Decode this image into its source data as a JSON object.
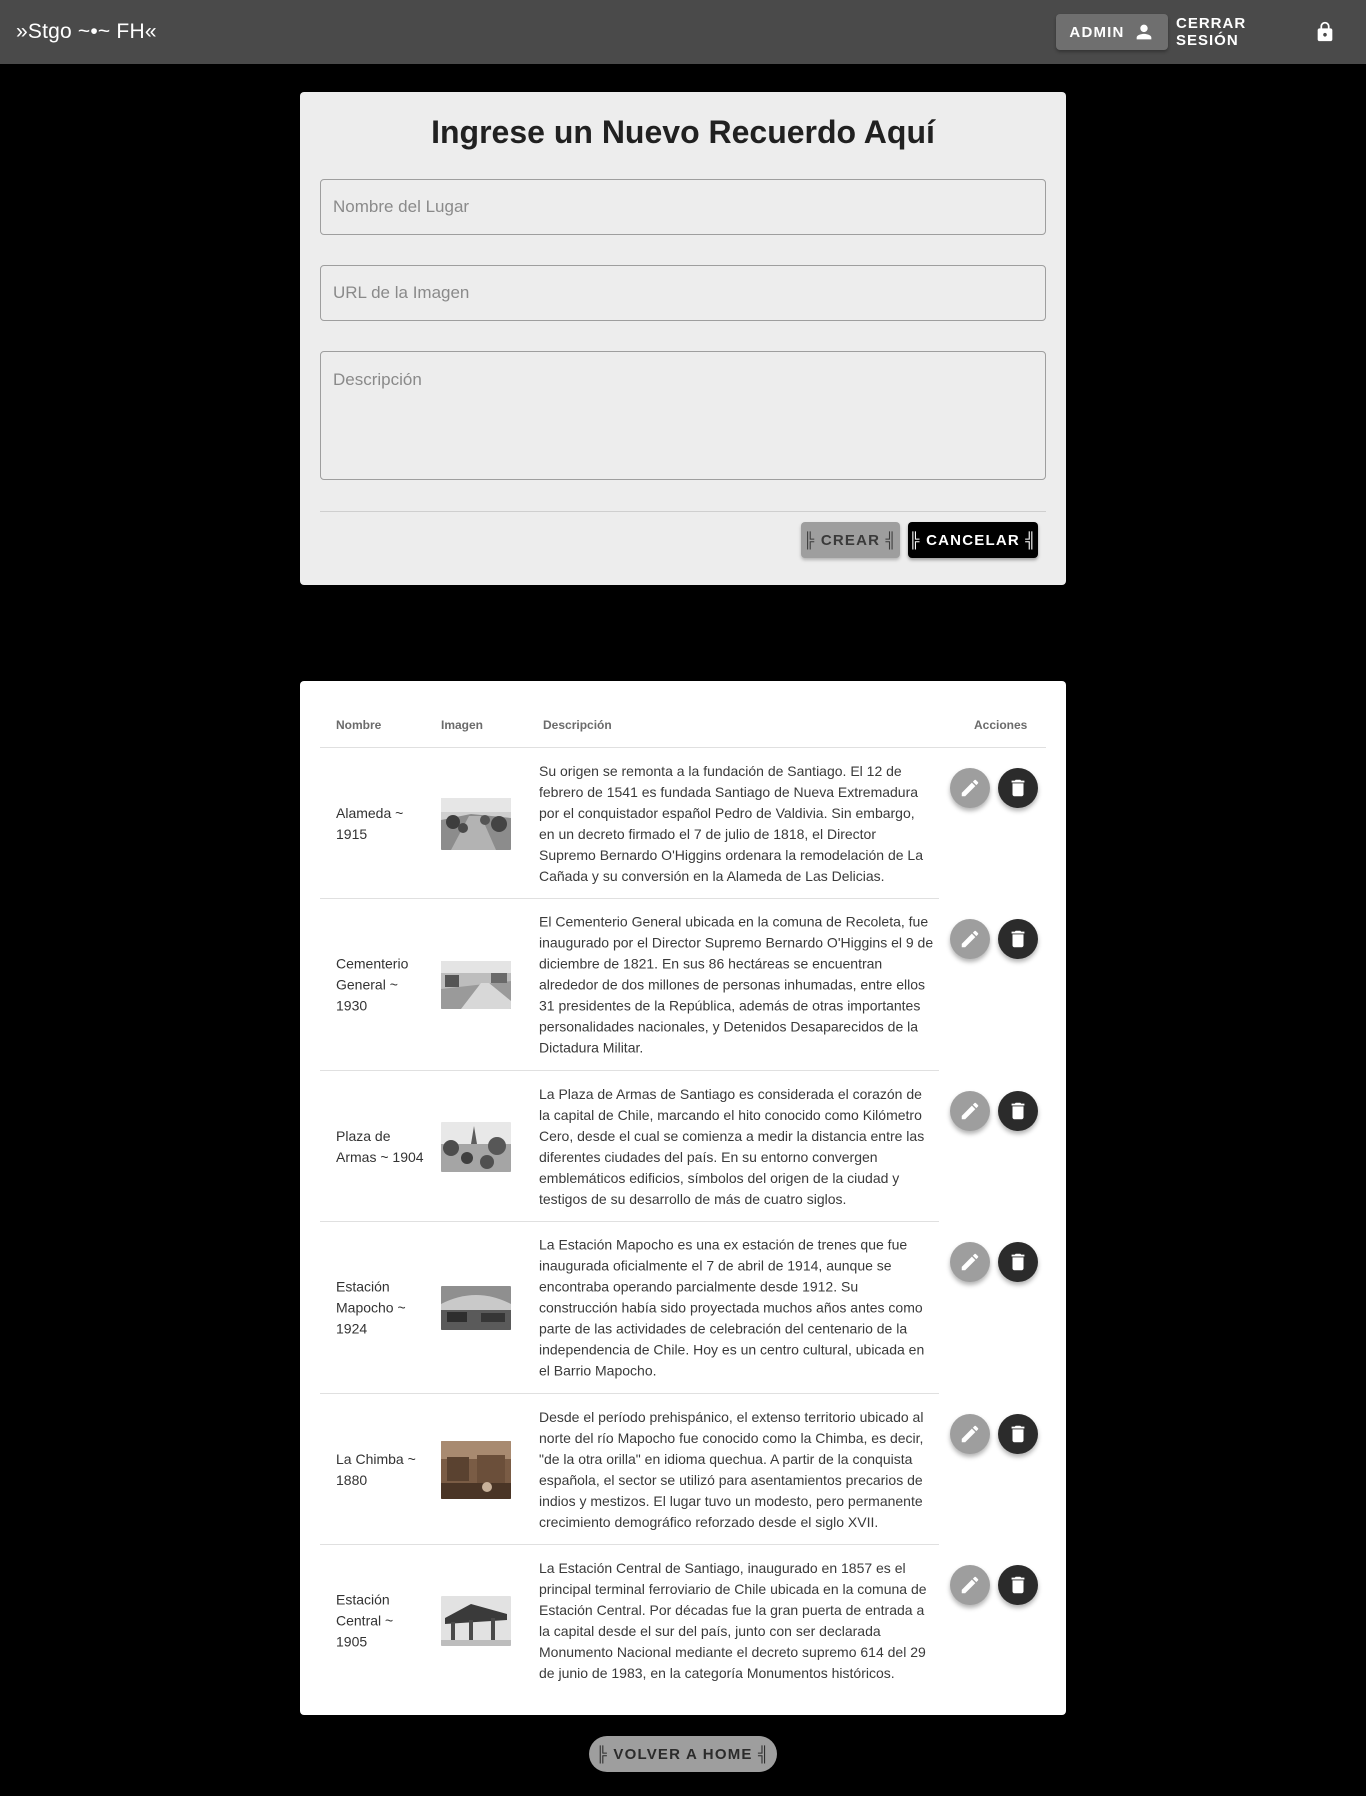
{
  "header": {
    "brand": "»Stgo ~•~ FH«",
    "admin_label": "ADMIN",
    "logout_label": "CERRAR SESIÓN"
  },
  "form": {
    "title": "Ingrese un Nuevo Recuerdo Aquí",
    "name_placeholder": "Nombre del Lugar",
    "url_placeholder": "URL de la Imagen",
    "desc_placeholder": "Descripción",
    "create_label": "╠ CREAR ╣",
    "cancel_label": "╠ CANCELAR ╣"
  },
  "table": {
    "headers": [
      "Nombre",
      "Imagen",
      "Descripción",
      "Acciones"
    ],
    "rows": [
      {
        "name": "Alameda ~ 1915",
        "description": "Su origen se remonta a la fundación de Santiago. El 12 de febrero de 1541 es fundada Santiago de Nueva Extremadura por el conquistador español Pedro de Valdivia. Sin embargo, en un decreto firmado el 7 de julio de 1818, el Director Supremo Bernardo O'Higgins ordenara la remodelación de La Cañada y su conversión en la Alameda de Las Delicias."
      },
      {
        "name": "Cementerio General ~ 1930",
        "description": "El Cementerio General ubicada en la comuna de Recoleta, fue inaugurado por el Director Supremo Bernardo O'Higgins el 9 de diciembre de 1821. En sus 86 hectáreas se encuentran alrededor de dos millones de personas inhumadas, entre ellos 31 presidentes de la República, además de otras importantes personalidades nacionales, y Detenidos Desaparecidos de la Dictadura Militar."
      },
      {
        "name": "Plaza de Armas ~ 1904",
        "description": "La Plaza de Armas de Santiago es considerada el corazón de la capital de Chile, marcando el hito conocido como Kilómetro Cero, desde el cual se comienza a medir la distancia entre las diferentes ciudades del país. En su entorno convergen emblemáticos edificios, símbolos del origen de la ciudad y testigos de su desarrollo de más de cuatro siglos."
      },
      {
        "name": "Estación Mapocho ~ 1924",
        "description": "La Estación Mapocho es una ex estación de trenes que fue inaugurada oficialmente el 7 de abril de 1914, aunque se encontraba operando parcialmente desde 1912. Su construcción había sido proyectada muchos años antes como parte de las actividades de celebración del centenario de la independencia de Chile. Hoy es un centro cultural, ubicada en el Barrio Mapocho."
      },
      {
        "name": "La Chimba ~ 1880",
        "description": "Desde el período prehispánico, el extenso territorio ubicado al norte del río Mapocho fue conocido como la Chimba, es decir, \"de la otra orilla\" en idioma quechua. A partir de la conquista española, el sector se utilizó para asentamientos precarios de indios y mestizos. El lugar tuvo un modesto, pero permanente crecimiento demográfico reforzado desde el siglo XVII."
      },
      {
        "name": "Estación Central ~ 1905",
        "description": "La Estación Central de Santiago, inaugurado en 1857 es el principal terminal ferroviario de Chile ubicada en la comuna de Estación Central. Por décadas fue la gran puerta de entrada a la capital desde el sur del país, junto con ser declarada Monumento Nacional mediante el decreto supremo 614 del 29 de junio de 1983, en la categoría Monumentos históricos."
      }
    ]
  },
  "footer": {
    "home_label": "╠ VOLVER A HOME ╣"
  },
  "icons": {
    "admin": "person-icon",
    "logout": "lock-icon",
    "edit": "pencil-icon",
    "delete": "trash-icon"
  },
  "colors": {
    "appbar": "#4a4a4a",
    "background": "#000000",
    "form_card": "#ededed",
    "edit_fab": "#9e9e9e",
    "delete_fab": "#2b2b2b"
  }
}
